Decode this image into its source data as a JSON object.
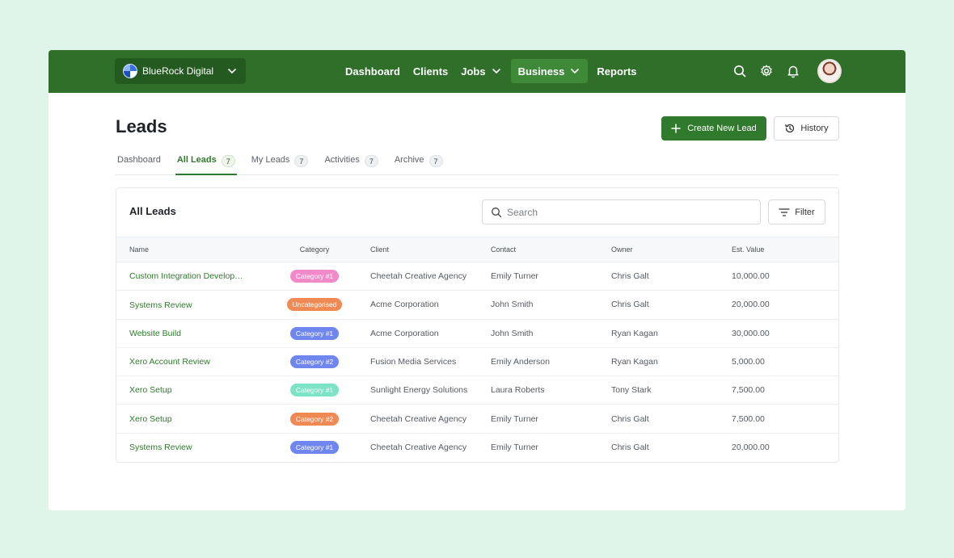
{
  "workspace": {
    "name": "BlueRock Digital"
  },
  "nav": [
    {
      "label": "Dashboard",
      "dropdown": false,
      "active": false
    },
    {
      "label": "Clients",
      "dropdown": false,
      "active": false
    },
    {
      "label": "Jobs",
      "dropdown": true,
      "active": false
    },
    {
      "label": "Business",
      "dropdown": true,
      "active": true
    },
    {
      "label": "Reports",
      "dropdown": false,
      "active": false
    }
  ],
  "page": {
    "title": "Leads",
    "create_label": "Create New Lead",
    "history_label": "History"
  },
  "tabs": [
    {
      "label": "Dashboard",
      "count": ""
    },
    {
      "label": "All Leads",
      "count": "7"
    },
    {
      "label": "My Leads",
      "count": "7"
    },
    {
      "label": "Activities",
      "count": "7"
    },
    {
      "label": "Archive",
      "count": "7"
    }
  ],
  "card": {
    "title": "All Leads",
    "search_placeholder": "Search",
    "filter_label": "Filter"
  },
  "table": {
    "headers": [
      "Name",
      "Category",
      "Client",
      "Contact",
      "Owner",
      "Est. Value"
    ],
    "rows": [
      {
        "name": "Custom Integration Development",
        "category": "Category #1",
        "cat_color": "#f28ac9",
        "client": "Cheetah Creative Agency",
        "contact": "Emily Turner",
        "owner": "Chris Galt",
        "value": "10,000.00"
      },
      {
        "name": "Systems Review",
        "category": "Uncategorised",
        "cat_color": "#f08a55",
        "client": "Acme Corporation",
        "contact": "John Smith",
        "owner": "Chris Galt",
        "value": "20,000.00"
      },
      {
        "name": "Website Build",
        "category": "Category #1",
        "cat_color": "#6f86ee",
        "client": "Acme Corporation",
        "contact": "John Smith",
        "owner": "Ryan Kagan",
        "value": "30,000.00"
      },
      {
        "name": "Xero Account Review",
        "category": "Category #2",
        "cat_color": "#6f86ee",
        "client": "Fusion Media Services",
        "contact": "Emily Anderson",
        "owner": "Ryan Kagan",
        "value": "5,000.00"
      },
      {
        "name": "Xero Setup",
        "category": "Category #1",
        "cat_color": "#7de3c6",
        "client": "Sunlight Energy Solutions",
        "contact": "Laura Roberts",
        "owner": "Tony Stark",
        "value": "7,500.00"
      },
      {
        "name": "Xero Setup",
        "category": "Category #2",
        "cat_color": "#f08a55",
        "client": "Cheetah Creative Agency",
        "contact": "Emily Turner",
        "owner": "Chris Galt",
        "value": "7,500.00"
      },
      {
        "name": "Systems Review",
        "category": "Category #1",
        "cat_color": "#6f86ee",
        "client": "Cheetah Creative Agency",
        "contact": "Emily Turner",
        "owner": "Chris Galt",
        "value": "20,000.00"
      }
    ]
  },
  "icons": {
    "workspace_logo": "globe-icon",
    "search": "search-icon",
    "settings": "gear-icon",
    "notifications": "bell-icon",
    "create": "plus-icon",
    "history": "history-icon",
    "filter": "filter-icon"
  },
  "colors": {
    "brand": "#2f6f2a",
    "accent": "#2f7a2c",
    "background": "#dff5ea"
  }
}
